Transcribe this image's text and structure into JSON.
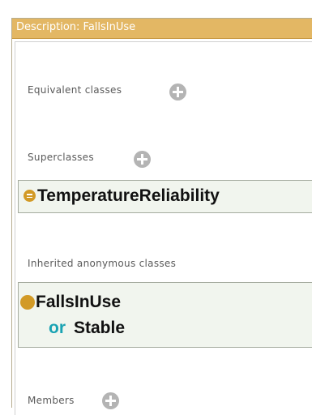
{
  "view": {
    "title": "Description: FallsInUse"
  },
  "sections": {
    "equivalent": {
      "label": "Equivalent classes"
    },
    "superclasses": {
      "label": "Superclasses",
      "item": "TemperatureReliability"
    },
    "inherited": {
      "label": "Inherited anonymous classes",
      "class_name": "FallsInUse",
      "operator": "or",
      "operand": "Stable"
    },
    "members": {
      "label": "Members"
    }
  },
  "colors": {
    "header": "#e3b764",
    "class_icon": "#d29a26",
    "keyword": "#1aa3b3",
    "frame_bg": "#f1f5ee",
    "add_button": "#b4b4b4"
  },
  "icons": {
    "add": "add-icon",
    "class": "class-icon",
    "equivalent_class": "equivalent-class-icon"
  }
}
